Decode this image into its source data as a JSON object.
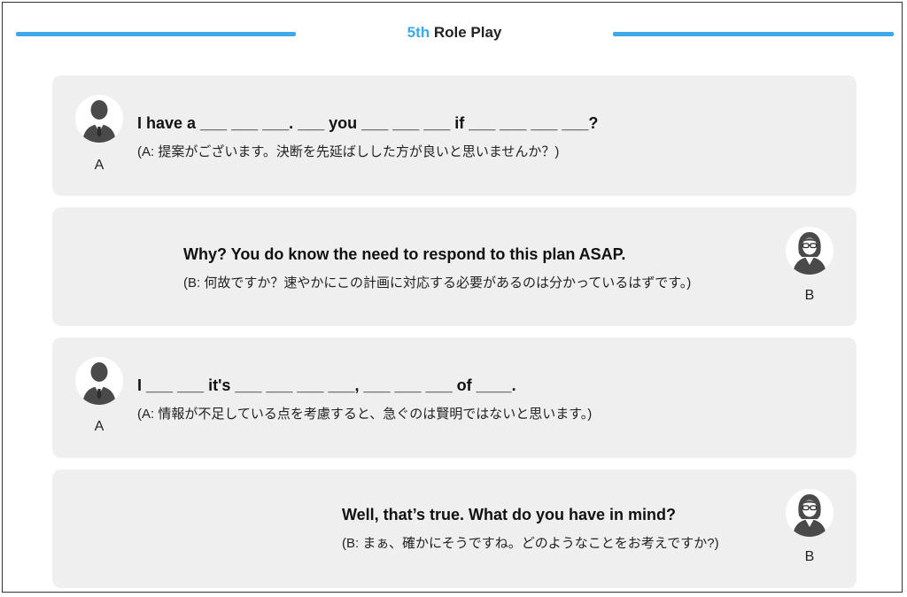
{
  "header": {
    "number": "5th",
    "label": "Role Play",
    "accent_color": "#3ea8e8"
  },
  "dialogue": [
    {
      "speaker": "A",
      "avatar": "man-avatar-icon",
      "english": "I have a ___ ___ ___. ___ you ___ ___ ___ if ___ ___ ___ ___?",
      "japanese": "(A: 提案がございます。決断を先延ばしした方が良いと思いませんか？)"
    },
    {
      "speaker": "B",
      "avatar": "woman-avatar-icon",
      "english": "Why? You do know the need to respond to this plan ASAP.",
      "japanese": "(B: 何故ですか？速やかにこの計画に対応する必要があるのは分かっているはずです。)"
    },
    {
      "speaker": "A",
      "avatar": "man-avatar-icon",
      "english": "I ___ ___ it's ___ ___ ___ ___, ___ ___ ___ of ____.",
      "japanese": "(A: 情報が不足している点を考慮すると、急ぐのは賢明ではないと思います。)"
    },
    {
      "speaker": "B",
      "avatar": "woman-avatar-icon",
      "english": "Well, that’s true. What do you have in mind?",
      "japanese": "(B: まぁ、確かにそうですね。どのようなことをお考えですか?)"
    }
  ]
}
